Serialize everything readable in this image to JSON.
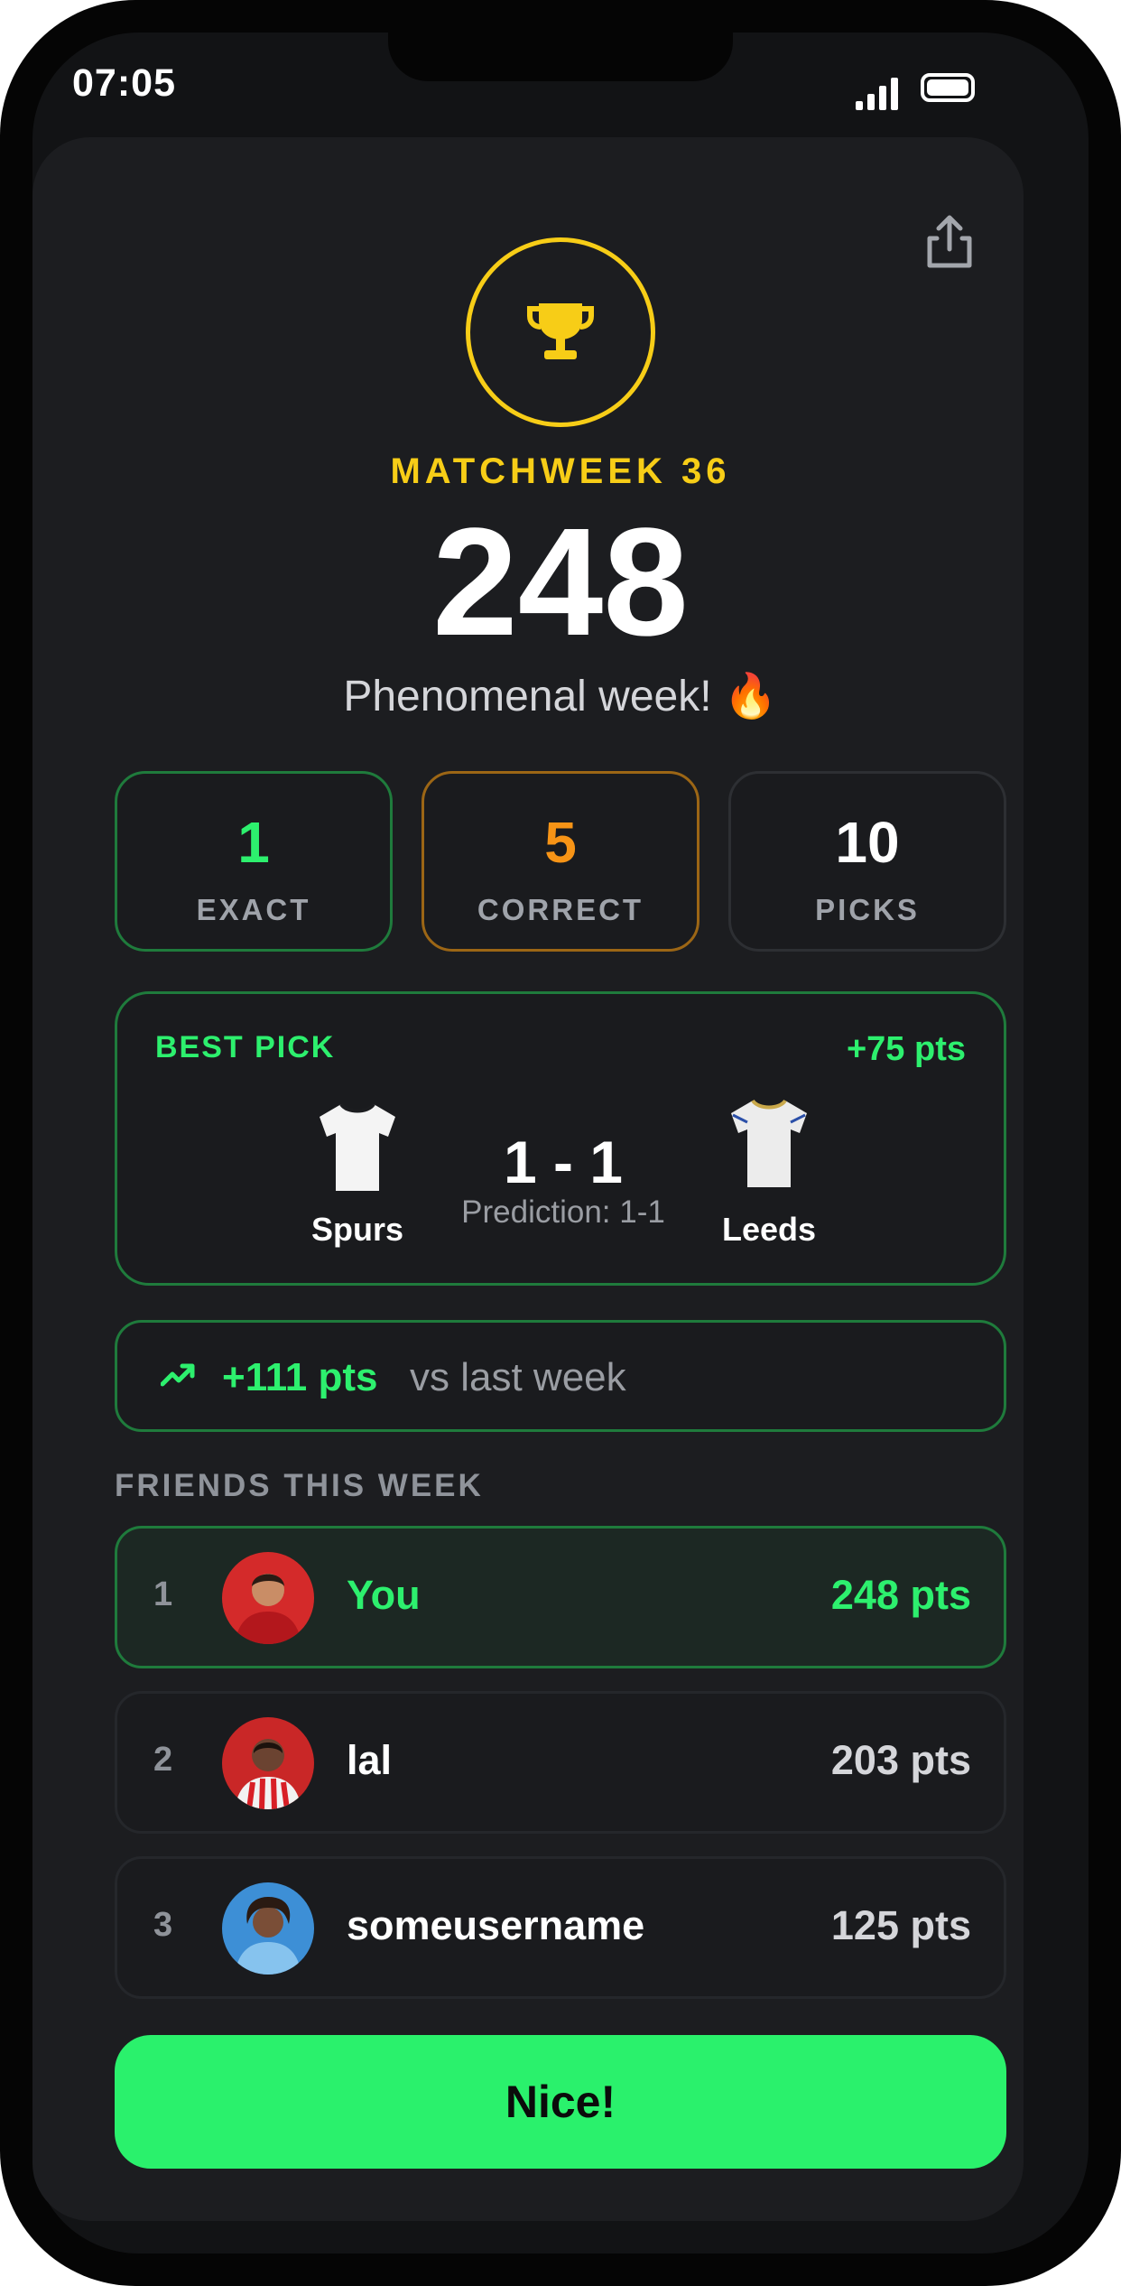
{
  "status_bar": {
    "time": "07:05"
  },
  "summary": {
    "matchweek": "MATCHWEEK 36",
    "score": "248",
    "tagline": "Phenomenal week! 🔥"
  },
  "stats": [
    {
      "value": "1",
      "label": "EXACT",
      "color": "#2df06e"
    },
    {
      "value": "5",
      "label": "CORRECT",
      "color": "#f79416"
    },
    {
      "value": "10",
      "label": "PICKS",
      "color": "#ffffff"
    }
  ],
  "best_pick": {
    "label": "BEST PICK",
    "points": "+75 pts",
    "home_team": "Spurs",
    "away_team": "Leeds",
    "score": "1 - 1",
    "prediction": "Prediction: 1-1"
  },
  "trend": {
    "gain": "+111 pts",
    "text": "vs last week"
  },
  "friends": {
    "title": "FRIENDS THIS WEEK",
    "rows": [
      {
        "rank": "1",
        "name": "You",
        "points": "248 pts"
      },
      {
        "rank": "2",
        "name": "lal",
        "points": "203 pts"
      },
      {
        "rank": "3",
        "name": "someusername",
        "points": "125 pts"
      }
    ]
  },
  "cta": {
    "label": "Nice!"
  },
  "colors": {
    "accent_green": "#2af16c",
    "gold": "#f7cd17",
    "orange": "#f79416",
    "card_bg": "#1c1d20"
  }
}
